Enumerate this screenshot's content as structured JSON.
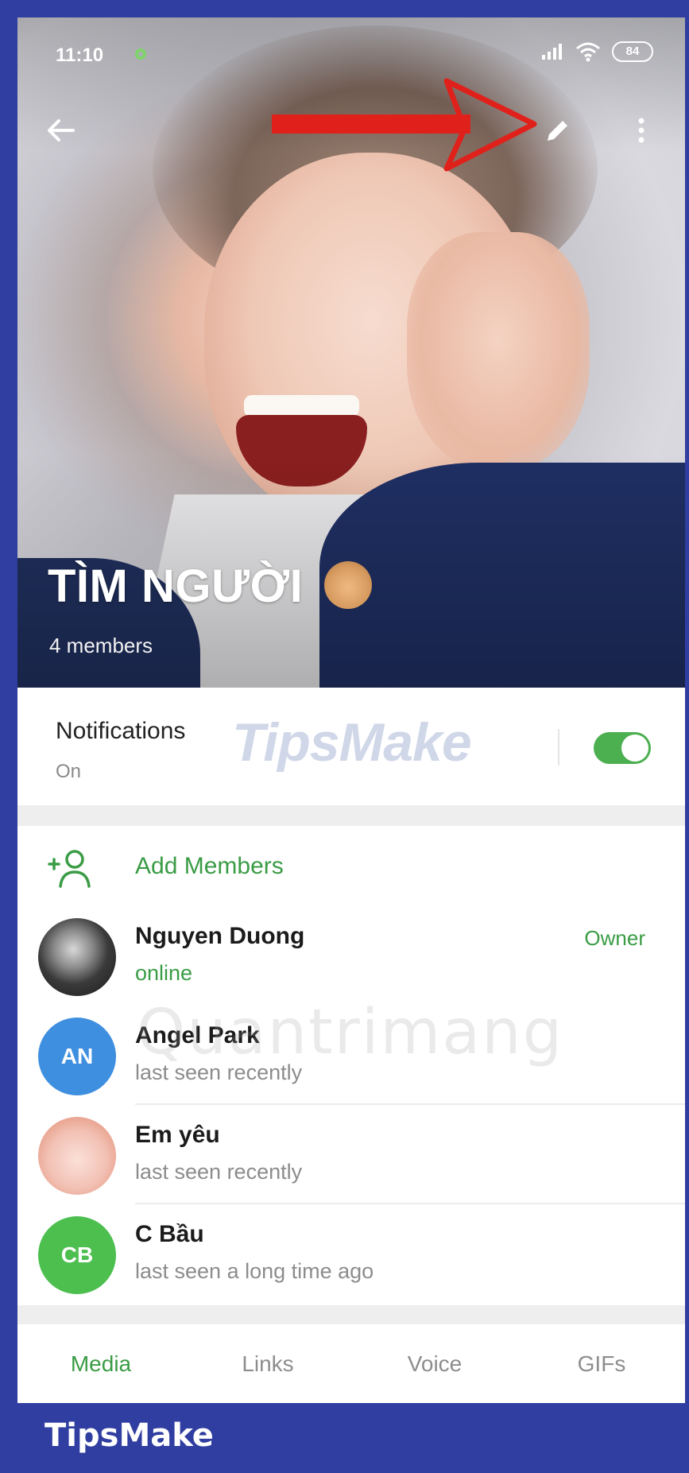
{
  "status_bar": {
    "time": "11:10",
    "battery": "84"
  },
  "group": {
    "title": "TÌM NGƯỜI",
    "members_count": "4 members"
  },
  "notifications": {
    "title": "Notifications",
    "state": "On",
    "enabled": true
  },
  "watermarks": {
    "tipsmake": "TipsMake",
    "quantrimang": "Quantrimang"
  },
  "add_members": {
    "label": "Add Members"
  },
  "members": [
    {
      "name": "Nguyen Duong",
      "status": "online",
      "role": "Owner",
      "avatar": "photo",
      "color": "#2b2b2b"
    },
    {
      "name": "Angel Park",
      "status": "last seen recently",
      "role": "",
      "avatar": "AN",
      "color": "#3f8fe0"
    },
    {
      "name": "Em yêu",
      "status": "last seen recently",
      "role": "",
      "avatar": "sticker",
      "color": "#f2c7b8"
    },
    {
      "name": "C Bầu",
      "status": "last seen a long time ago",
      "role": "",
      "avatar": "CB",
      "color": "#4cbf4f"
    }
  ],
  "tabs": [
    {
      "label": "Media",
      "active": true
    },
    {
      "label": "Links",
      "active": false
    },
    {
      "label": "Voice",
      "active": false
    },
    {
      "label": "GIFs",
      "active": false
    }
  ],
  "footer": {
    "brand": "TipsMake"
  },
  "colors": {
    "accent": "#3a9c45",
    "frame": "#2f3ea0",
    "arrow": "#e0211b"
  },
  "icons": [
    "back-arrow-icon",
    "edit-pencil-icon",
    "more-vertical-icon",
    "add-member-icon",
    "see-no-evil-monkey-emoji"
  ]
}
